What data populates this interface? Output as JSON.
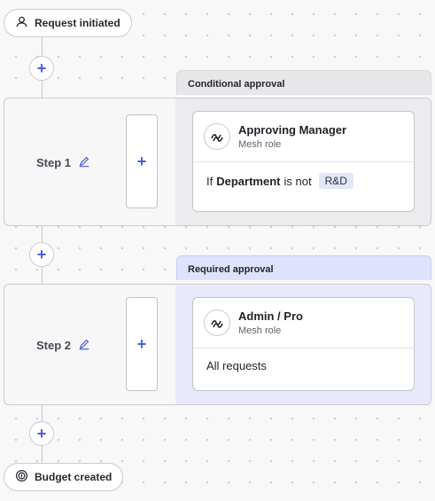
{
  "flow": {
    "start_label": "Request initiated",
    "end_label": "Budget created",
    "add_symbol": "+"
  },
  "steps": [
    {
      "band_label": "Conditional approval",
      "step_label": "Step 1",
      "role_title": "Approving Manager",
      "role_subtitle": "Mesh role",
      "condition": {
        "prefix": "If",
        "field": "Department",
        "operator": "is not",
        "value": "R&D"
      }
    },
    {
      "band_label": "Required approval",
      "step_label": "Step 2",
      "role_title": "Admin / Pro",
      "role_subtitle": "Mesh role",
      "condition_text": "All requests"
    }
  ],
  "colors": {
    "accent": "#4a5fd9",
    "conditional_band": "#e7e7e9",
    "required_band": "#dfe2fb"
  },
  "icons": {
    "start": "user-icon",
    "end": "coin-icon",
    "edit": "pencil-icon",
    "role": "mesh-role-icon"
  }
}
